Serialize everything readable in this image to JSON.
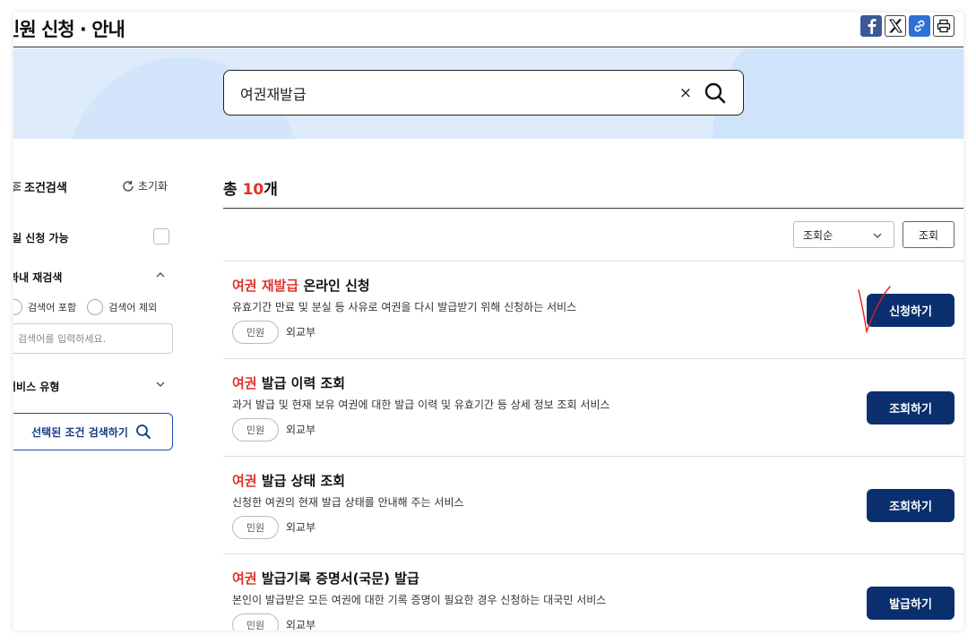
{
  "header": {
    "title": "민원 신청 · 안내",
    "share_buttons": [
      {
        "name": "facebook-icon"
      },
      {
        "name": "x-icon"
      },
      {
        "name": "link-icon"
      },
      {
        "name": "print-icon"
      }
    ]
  },
  "search": {
    "value": "여권재발급",
    "clear_glyph": "×"
  },
  "sidebar": {
    "filter_title": "조건검색",
    "reset_label": "초기화",
    "mobile_label": "모바일 신청 가능",
    "research_label": "결과내 재검색",
    "radio_include": "검색어 포함",
    "radio_exclude": "검색어 제외",
    "keyword_placeholder": "검색어를 입력하세요.",
    "service_type_label": "서비스 유형",
    "apply_label": "선택된 조건 검색하기"
  },
  "results": {
    "total_prefix": "총 ",
    "total_count": "10",
    "total_suffix": "개",
    "sort_value": "조회순",
    "sort_button": "조회",
    "items": [
      {
        "title_highlight": "여권 재발급",
        "title_rest": " 온라인 신청",
        "desc": "유효기간 만료 및 분실 등 사유로 여권을 다시 발급받기 위해 신청하는 서비스",
        "tag": "민원",
        "org": "외교부",
        "action": "신청하기"
      },
      {
        "title_highlight": "여권",
        "title_rest": " 발급 이력 조회",
        "desc": "과거 발급 및 현재 보유 여권에 대한 발급 이력 및 유효기간 등 상세 정보 조회 서비스",
        "tag": "민원",
        "org": "외교부",
        "action": "조회하기"
      },
      {
        "title_highlight": "여권",
        "title_rest": " 발급 상태 조회",
        "desc": "신청한 여권의 현재 발급 상태를 안내해 주는 서비스",
        "tag": "민원",
        "org": "외교부",
        "action": "조회하기"
      },
      {
        "title_highlight": "여권",
        "title_rest": " 발급기록 증명서(국문) 발급",
        "desc": "본인이 발급받은 모든 여권에 대한 기록 증명이 필요한 경우 신청하는 대국민 서비스",
        "tag": "민원",
        "org": "외교부",
        "action": "발급하기"
      }
    ]
  },
  "colors": {
    "accent_red": "#e0322b",
    "button_navy": "#0b2f6e",
    "banner_blue": "#ddebfb",
    "handwritten_check": "#e01e1e"
  }
}
